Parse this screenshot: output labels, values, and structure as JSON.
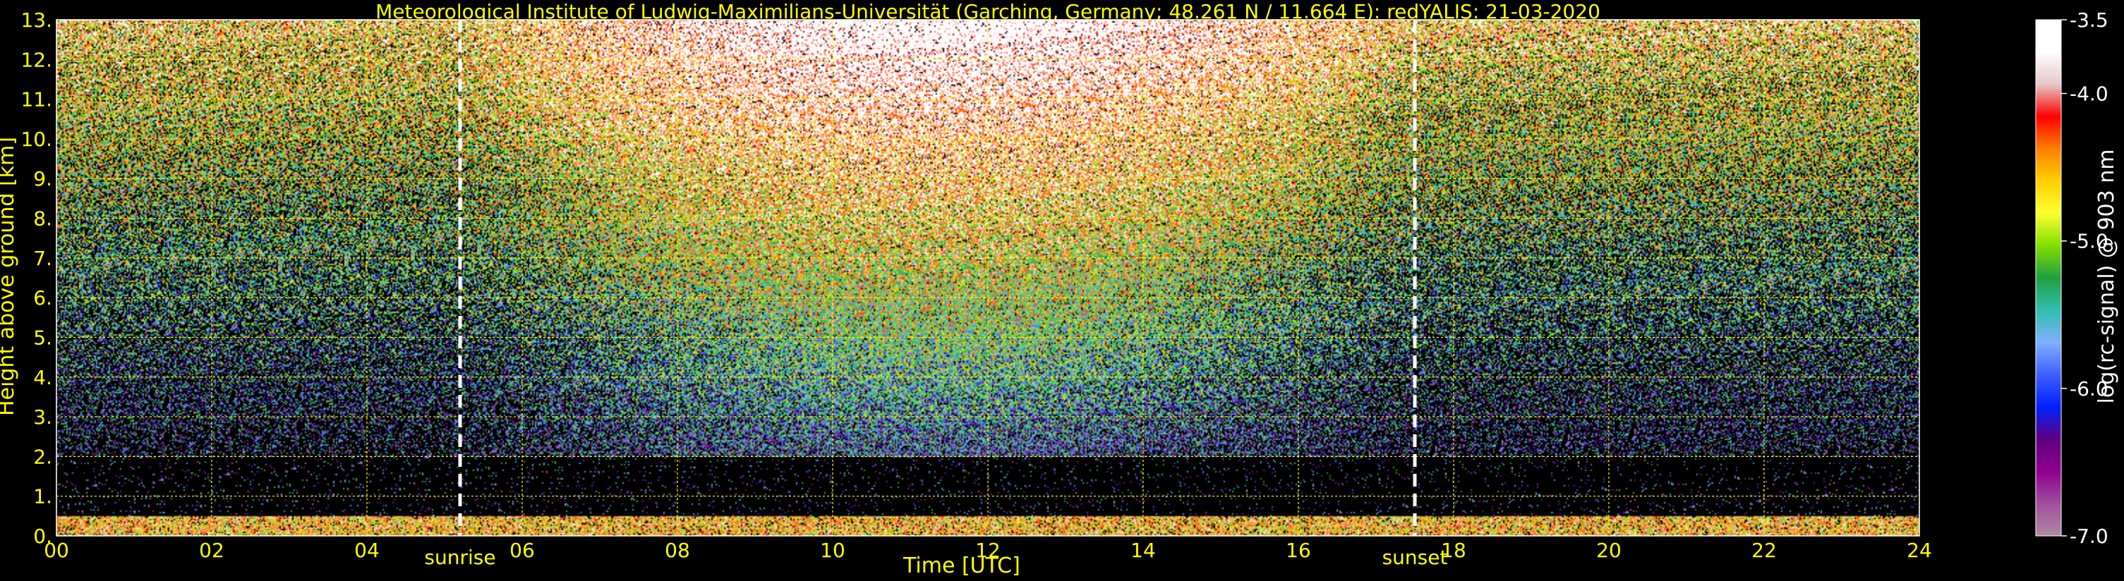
{
  "chart_data": {
    "type": "heatmap",
    "title": "Meteorological Institute of Ludwig-Maximilians-Universität (Garching, Germany; 48.261 N / 11.664 E):    redYALIS: 21-03-2020",
    "xlabel": "Time [UTC]",
    "ylabel": "Height above ground [km]",
    "xlim": [
      0,
      24
    ],
    "ylim": [
      0,
      13
    ],
    "xticks": [
      "00",
      "02",
      "04",
      "06",
      "08",
      "10",
      "12",
      "14",
      "16",
      "18",
      "20",
      "22",
      "24"
    ],
    "xtick_values": [
      0,
      2,
      4,
      6,
      8,
      10,
      12,
      14,
      16,
      18,
      20,
      22,
      24
    ],
    "yticks": [
      "0.",
      "1.",
      "2.",
      "3.",
      "4.",
      "5.",
      "6.",
      "7.",
      "8.",
      "9.",
      "10.",
      "11.",
      "12.",
      "13."
    ],
    "ytick_values": [
      0,
      1,
      2,
      3,
      4,
      5,
      6,
      7,
      8,
      9,
      10,
      11,
      12,
      13
    ],
    "grid": true,
    "annotations": [
      {
        "label": "sunrise",
        "x": 5.2
      },
      {
        "label": "sunset",
        "x": 17.5
      }
    ],
    "colorbar": {
      "label": "log(rc-signal) @ 903 nm",
      "ticks": [
        "-3.5",
        "-4.0",
        "-5.0",
        "-6.0",
        "-7.0"
      ],
      "tick_values": [
        -3.5,
        -4.0,
        -5.0,
        -6.0,
        -7.0
      ],
      "range": [
        -7.0,
        -3.5
      ]
    },
    "colors": {
      "axis_text": "#ffff00",
      "grid": "#ffff00",
      "marker_line": "#ffffff",
      "cbar_text": "#ffffff"
    }
  }
}
